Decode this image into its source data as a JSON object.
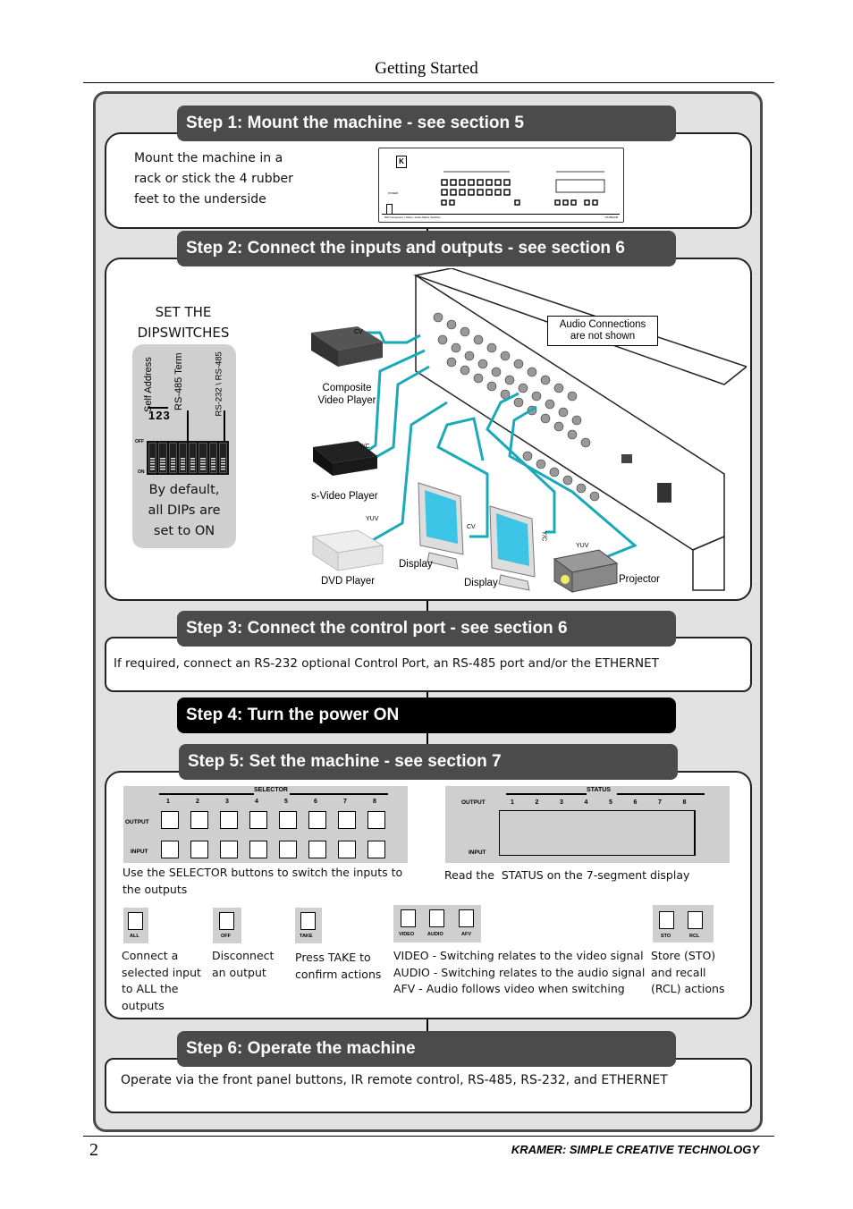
{
  "page": {
    "header_title": "Getting Started",
    "page_number": "2",
    "footer_brand": "KRAMER:  SIMPLE CREATIVE TECHNOLOGY"
  },
  "colors": {
    "step_header": "#4b4b4b",
    "step_header_highlight": "#000000",
    "cable": "#1aa9b8",
    "panel_bg": "#e2e2e2"
  },
  "steps": [
    {
      "title": "Step 1: Mount the machine - see section 5",
      "body": [
        "Mount the machine in a",
        "rack or stick the 4 rubber",
        "feet to the underside"
      ]
    },
    {
      "title": "Step 2: Connect the inputs and outputs - see section 6"
    },
    {
      "title": "Step 3: Connect the control port - see section 6",
      "body": "If required, connect an RS-232 optional Control Port, an RS-485 port and/or the ETHERNET"
    },
    {
      "title": "Step 4: Turn the power ON"
    },
    {
      "title": "Step 5: Set the machine - see section 7"
    },
    {
      "title": "Step 6: Operate the machine",
      "body": "Operate via the front panel buttons, IR remote control, RS-485, RS-232, and ETHERNET"
    }
  ],
  "front_panel": {
    "logo": "K",
    "power_label": "POWER",
    "model_caption": "8x8 Component / Video / Audio Matrix Switcher",
    "model_code": "VS-88HCB"
  },
  "dipswitches": {
    "heading": [
      "SET THE",
      "DIPSWITCHES"
    ],
    "labels": [
      "Self Address",
      "RS-485 Term",
      "RS-232 \\ RS-485"
    ],
    "numbers": "123",
    "off_label": "OFF",
    "on_label": "ON",
    "count": 8,
    "default_note": [
      "By default,",
      "all DIPs are",
      "set to ON"
    ]
  },
  "diagram": {
    "note": [
      "Audio Connections",
      "are not shown"
    ],
    "devices": {
      "composite": [
        "Composite",
        "Video Player"
      ],
      "svideo": "s-Video Player",
      "dvd": "DVD Player",
      "display1": "Display",
      "display2": "Display",
      "projector": "Projector"
    },
    "signals": {
      "cv_in": "CV",
      "yc_in": "Y/C",
      "yuv_in": "YUV",
      "cv_out": "CV",
      "yc_out": "Y/C",
      "yuv_out": "YUV"
    }
  },
  "selector": {
    "title": "SELECTOR",
    "numbers": [
      "1",
      "2",
      "3",
      "4",
      "5",
      "6",
      "7",
      "8"
    ],
    "output_label": "OUTPUT",
    "input_label": "INPUT",
    "caption": [
      "Use the SELECTOR buttons to switch the inputs to",
      "the outputs"
    ]
  },
  "status": {
    "title": "STATUS",
    "numbers": [
      "1",
      "2",
      "3",
      "4",
      "5",
      "6",
      "7",
      "8"
    ],
    "output_label": "OUTPUT",
    "input_label": "INPUT",
    "caption": "Read the  STATUS on the 7-segment display"
  },
  "function_buttons": [
    {
      "labels": [
        "ALL"
      ],
      "caption": [
        "Connect a",
        "selected input",
        "to ALL the",
        "outputs"
      ]
    },
    {
      "labels": [
        "OFF"
      ],
      "caption": [
        "Disconnect",
        "an output"
      ]
    },
    {
      "labels": [
        "TAKE"
      ],
      "caption": [
        "Press TAKE to",
        "confirm actions"
      ]
    },
    {
      "labels": [
        "VIDEO",
        "AUDIO",
        "AFV"
      ],
      "caption": [
        "VIDEO - Switching relates to the video signal",
        "AUDIO - Switching relates to the audio signal",
        "AFV - Audio follows video when switching"
      ]
    },
    {
      "labels": [
        "STO",
        "RCL"
      ],
      "caption": [
        "Store (STO)",
        "and recall",
        "(RCL) actions"
      ]
    }
  ]
}
